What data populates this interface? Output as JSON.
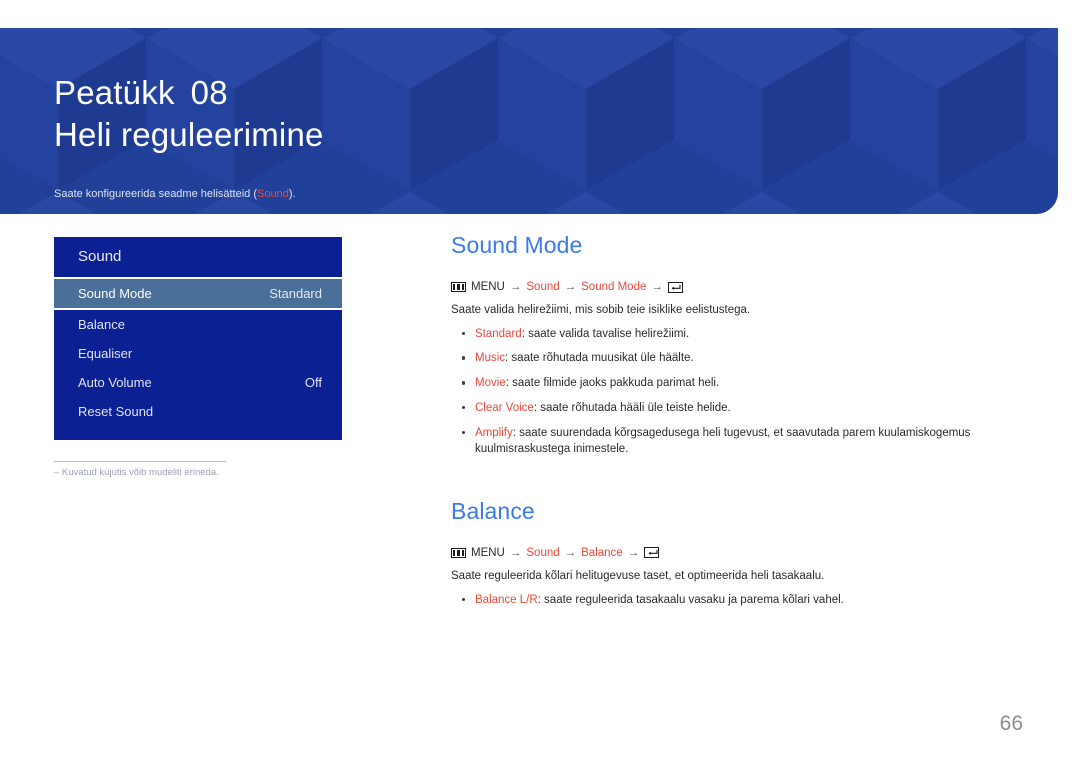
{
  "header": {
    "chapter_label": "Peatükk",
    "chapter_number": "08",
    "title": "Heli reguleerimine",
    "subtitle_before": "Saate konfigureerida seadme helisätteid (",
    "subtitle_keyword": "Sound",
    "subtitle_after": ").",
    "bg_color": "#21409a",
    "keyword_color": "#e8483a"
  },
  "osd_menu": {
    "title": "Sound",
    "rows": [
      {
        "label": "Sound Mode",
        "value": "Standard",
        "selected": true
      },
      {
        "label": "Balance",
        "value": "",
        "selected": false
      },
      {
        "label": "Equaliser",
        "value": "",
        "selected": false
      },
      {
        "label": "Auto Volume",
        "value": "Off",
        "selected": false
      },
      {
        "label": "Reset Sound",
        "value": "",
        "selected": false
      }
    ],
    "bg_color": "#0a2093",
    "selected_color": "#4a6f99"
  },
  "footnote": {
    "text": "–  Kuvatud kujutis võib mudeliti erineda."
  },
  "sections": [
    {
      "title": "Sound Mode",
      "path": {
        "menu_icon": "menu-icon",
        "menu_label": "MENU",
        "step1": "Sound",
        "step2": "Sound Mode",
        "enter_icon": "enter-key-icon",
        "arrow": "→"
      },
      "intro": "Saate valida helirežiimi, mis sobib teie isiklike eelistustega.",
      "bullets": [
        {
          "keyword": "Standard",
          "text": ": saate valida tavalise helirežiimi."
        },
        {
          "keyword": "Music",
          "text": ": saate rõhutada muusikat üle häälte."
        },
        {
          "keyword": "Movie",
          "text": ": saate filmide jaoks pakkuda parimat heli."
        },
        {
          "keyword": "Clear Voice",
          "text": ": saate rõhutada hääli üle teiste helide."
        },
        {
          "keyword": "Amplify",
          "text": ": saate suurendada kõrgsagedusega heli tugevust, et saavutada parem kuulamiskogemus kuulmisraskustega inimestele."
        }
      ]
    },
    {
      "title": "Balance",
      "path": {
        "menu_icon": "menu-icon",
        "menu_label": "MENU",
        "step1": "Sound",
        "step2": "Balance",
        "enter_icon": "enter-key-icon",
        "arrow": "→"
      },
      "intro": "Saate reguleerida kõlari helitugevuse taset, et optimeerida heli tasakaalu.",
      "bullets": [
        {
          "keyword": "Balance L/R",
          "text": ": saate reguleerida tasakaalu vasaku ja parema kõlari vahel."
        }
      ]
    }
  ],
  "page_number": "66",
  "accent_color": "#3a7be8"
}
